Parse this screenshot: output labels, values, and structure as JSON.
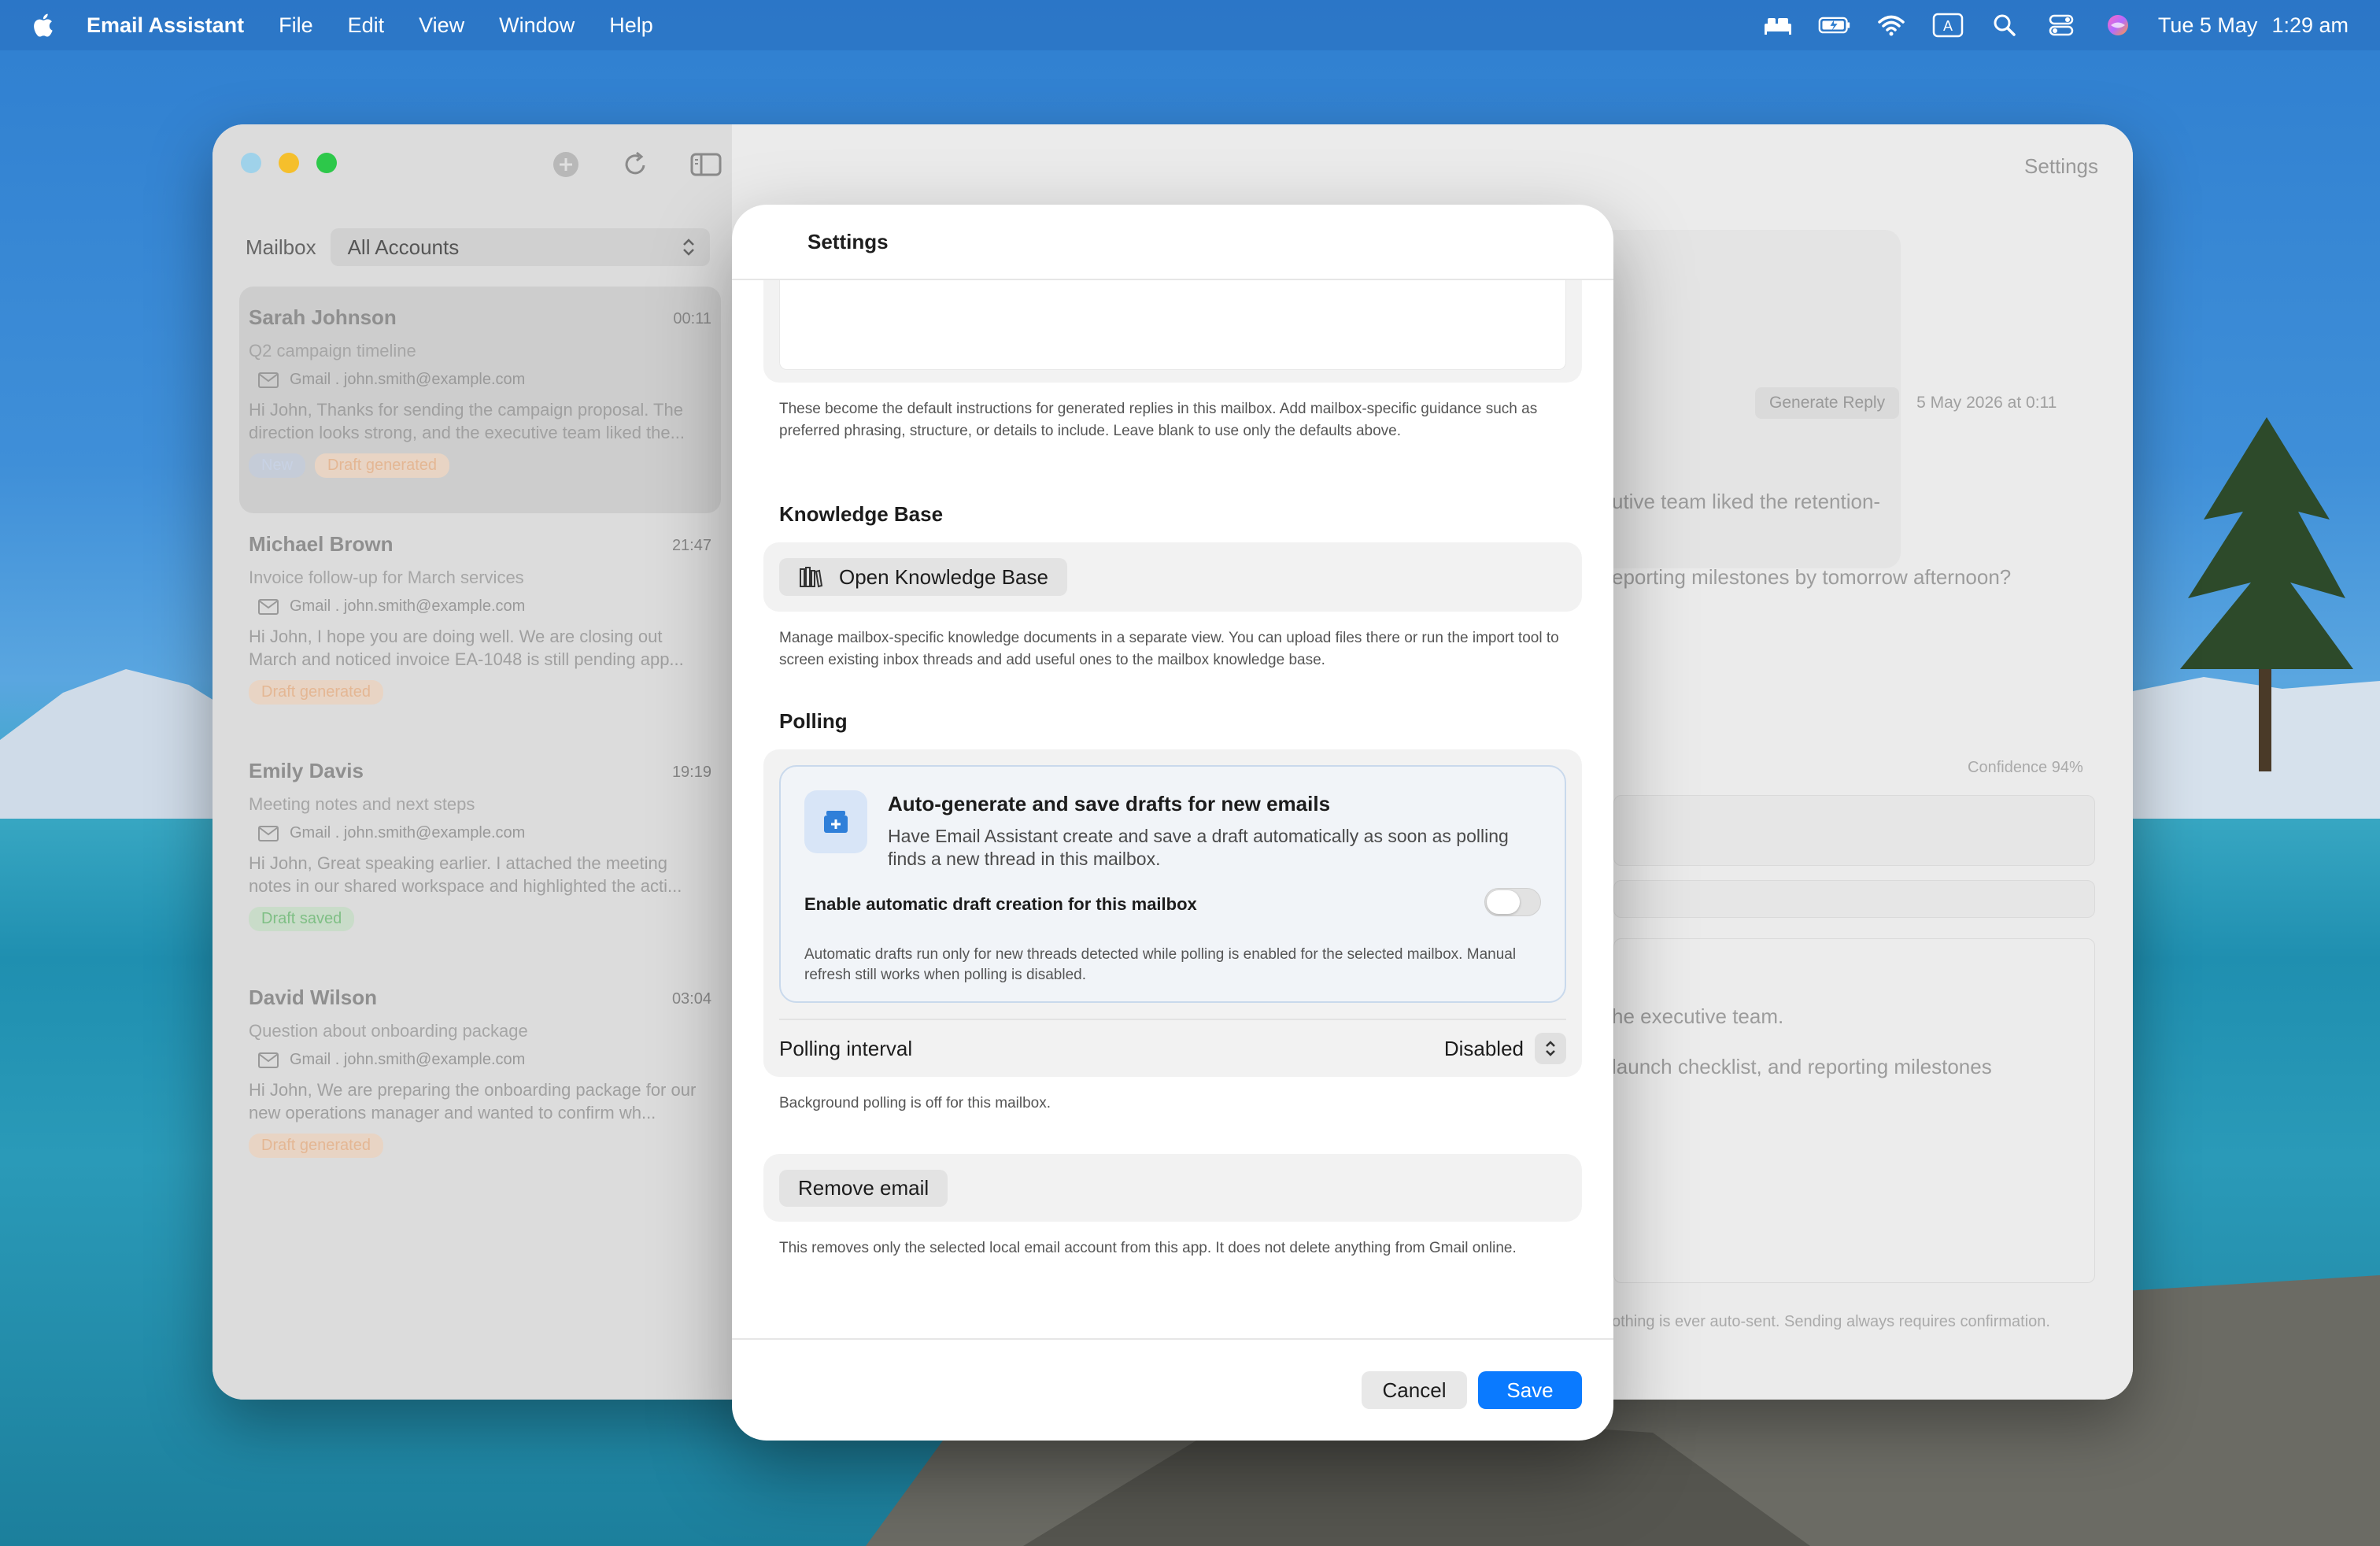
{
  "menubar": {
    "app_name": "Email Assistant",
    "menus": [
      "File",
      "Edit",
      "View",
      "Window",
      "Help"
    ],
    "date": "Tue 5 May",
    "time": "1:29 am",
    "input_indicator": "A"
  },
  "sidebar": {
    "mailbox_label": "Mailbox",
    "account_selected": "All Accounts",
    "emails": [
      {
        "sender": "Sarah Johnson",
        "time": "00:11",
        "subject": "Q2 campaign timeline",
        "account": "Gmail . john.smith@example.com",
        "preview": "Hi John,  Thanks for sending the campaign proposal. The direction looks strong, and the executive team liked the...",
        "tags": [
          "New",
          "Draft generated"
        ]
      },
      {
        "sender": "Michael Brown",
        "time": "21:47",
        "subject": "Invoice follow-up for March services",
        "account": "Gmail . john.smith@example.com",
        "preview": "Hi John,  I hope you are doing well. We are closing out March and noticed invoice EA-1048 is still pending app...",
        "tags": [
          "Draft generated"
        ]
      },
      {
        "sender": "Emily Davis",
        "time": "19:19",
        "subject": "Meeting notes and next steps",
        "account": "Gmail . john.smith@example.com",
        "preview": "Hi John,  Great speaking earlier. I attached the meeting notes in our shared workspace and highlighted the acti...",
        "tags": [
          "Draft saved"
        ]
      },
      {
        "sender": "David Wilson",
        "time": "03:04",
        "subject": "Question about onboarding package",
        "account": "Gmail . john.smith@example.com",
        "preview": "Hi John,  We are preparing the onboarding package for our new operations manager and wanted to confirm wh...",
        "tags": [
          "Draft generated"
        ]
      }
    ]
  },
  "content": {
    "settings_button": "Settings",
    "generate_reply": "Generate Reply",
    "reply_date": "5 May 2026 at 0:11",
    "line1": "utive team liked the retention-",
    "line2": "eporting milestones by tomorrow afternoon?",
    "confidence": "Confidence 94%",
    "line3": "he executive team.",
    "line4": "launch checklist, and reporting milestones",
    "footer": "othing is ever auto-sent. Sending always requires confirmation."
  },
  "dialog": {
    "title": "Settings",
    "instructions_help": "These become the default instructions for generated replies in this mailbox. Add mailbox-specific guidance such as preferred phrasing, structure, or details to include. Leave blank to use only the defaults above.",
    "knowledge_base": {
      "title": "Knowledge Base",
      "button": "Open Knowledge Base",
      "help": "Manage mailbox-specific knowledge documents in a separate view. You can upload files there or run the import tool to screen existing inbox threads and add useful ones to the mailbox knowledge base."
    },
    "polling": {
      "title": "Polling",
      "card_title": "Auto-generate and save drafts for new emails",
      "card_desc": "Have Email Assistant create and save a draft automatically as soon as polling finds a new thread in this mailbox.",
      "toggle_label": "Enable automatic draft creation for this mailbox",
      "toggle_on": false,
      "note": "Automatic drafts run only for new threads detected while polling is enabled for the selected mailbox. Manual refresh still works when polling is disabled.",
      "interval_label": "Polling interval",
      "interval_value": "Disabled",
      "interval_help": "Background polling is off for this mailbox."
    },
    "remove": {
      "button": "Remove email",
      "help": "This removes only the selected local email account from this app. It does not delete anything from Gmail online."
    },
    "cancel": "Cancel",
    "save": "Save"
  },
  "colors": {
    "accent": "#0a7aff",
    "toggle_off": "#e2e2e2",
    "card_border": "#c9d9ec"
  }
}
